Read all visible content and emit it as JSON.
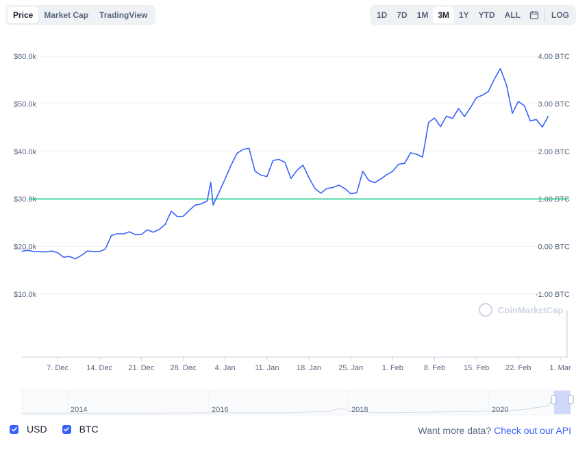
{
  "tabs": [
    {
      "label": "Price",
      "active": true
    },
    {
      "label": "Market Cap",
      "active": false
    },
    {
      "label": "TradingView",
      "active": false
    }
  ],
  "ranges": [
    {
      "label": "1D",
      "active": false
    },
    {
      "label": "7D",
      "active": false
    },
    {
      "label": "1M",
      "active": false
    },
    {
      "label": "3M",
      "active": true
    },
    {
      "label": "1Y",
      "active": false
    },
    {
      "label": "YTD",
      "active": false
    },
    {
      "label": "ALL",
      "active": false
    }
  ],
  "calendar_icon": "calendar-icon",
  "log_label": "LOG",
  "watermark": "CoinMarketCap",
  "legend": [
    {
      "label": "USD",
      "checked": true
    },
    {
      "label": "BTC",
      "checked": true
    }
  ],
  "api": {
    "text": "Want more data?",
    "link": "Check out our API"
  },
  "colors": {
    "line": "#3861fb",
    "btc_line": "#16c784",
    "accent": "#3861fb"
  },
  "chart_data": {
    "type": "line",
    "left_axis": {
      "ticks": [
        "$60.0k",
        "$50.0k",
        "$40.0k",
        "$30.0k",
        "$20.0k",
        "$10.0k"
      ],
      "values": [
        60000,
        50000,
        40000,
        30000,
        20000,
        10000
      ]
    },
    "right_axis": {
      "ticks": [
        "4.00 BTC",
        "3.00 BTC",
        "2.00 BTC",
        "1.00 BTC",
        "0.00 BTC",
        "-1.00 BTC"
      ],
      "values": [
        4,
        3,
        2,
        1,
        0,
        -1
      ]
    },
    "x_ticks": [
      "7. Dec",
      "14. Dec",
      "21. Dec",
      "28. Dec",
      "4. Jan",
      "11. Jan",
      "18. Jan",
      "25. Jan",
      "1. Feb",
      "8. Feb",
      "15. Feb",
      "22. Feb",
      "1. Mar"
    ],
    "x_tick_days": [
      7,
      14,
      21,
      28,
      35,
      42,
      49,
      56,
      63,
      70,
      77,
      84,
      91
    ],
    "navigator_labels": [
      "2014",
      "2016",
      "2018",
      "2020"
    ],
    "btc_series": {
      "name": "BTC",
      "value": 1.0
    },
    "usd_series": {
      "name": "USD",
      "days": [
        1,
        2,
        3,
        4,
        5,
        6,
        7,
        8,
        9,
        10,
        11,
        12,
        13,
        14,
        15,
        16,
        17,
        18,
        19,
        20,
        21,
        22,
        23,
        24,
        25,
        26,
        27,
        28,
        29,
        30,
        31,
        32,
        32.6,
        33,
        34,
        35,
        36,
        37,
        38,
        39,
        40,
        41,
        42,
        43,
        44,
        45,
        46,
        47,
        48,
        49,
        50,
        51,
        52,
        53,
        54,
        55,
        56,
        57,
        58,
        59,
        60,
        61,
        62,
        63,
        64,
        65,
        66,
        67,
        68,
        69,
        70,
        71,
        72,
        73,
        74,
        75,
        76,
        77,
        78,
        79,
        80,
        81,
        82,
        83,
        84,
        85,
        86,
        87,
        88,
        89,
        90,
        91
      ],
      "values": [
        19000,
        19200,
        18950,
        18900,
        18850,
        19050,
        18700,
        17750,
        17900,
        17400,
        18150,
        19050,
        18950,
        18900,
        19500,
        22300,
        22700,
        22650,
        23100,
        22500,
        22500,
        23500,
        23000,
        23600,
        24650,
        27400,
        26300,
        26350,
        27600,
        28700,
        28950,
        29600,
        33500,
        28700,
        31400,
        34200,
        37100,
        39600,
        40400,
        40650,
        35800,
        35000,
        34700,
        38100,
        38300,
        37700,
        34300,
        36000,
        37100,
        34500,
        32200,
        31200,
        32200,
        32400,
        32900,
        32200,
        31100,
        31300,
        35800,
        33900,
        33400,
        34200,
        35100,
        35800,
        37300,
        37500,
        39700,
        39400,
        38800,
        46100,
        47000,
        45200,
        47400,
        46900,
        49000,
        47300,
        49200,
        51300,
        51800,
        52600,
        55200,
        57400,
        54000,
        48000,
        50500,
        49600,
        46400,
        46700,
        45100,
        47400
      ]
    }
  }
}
